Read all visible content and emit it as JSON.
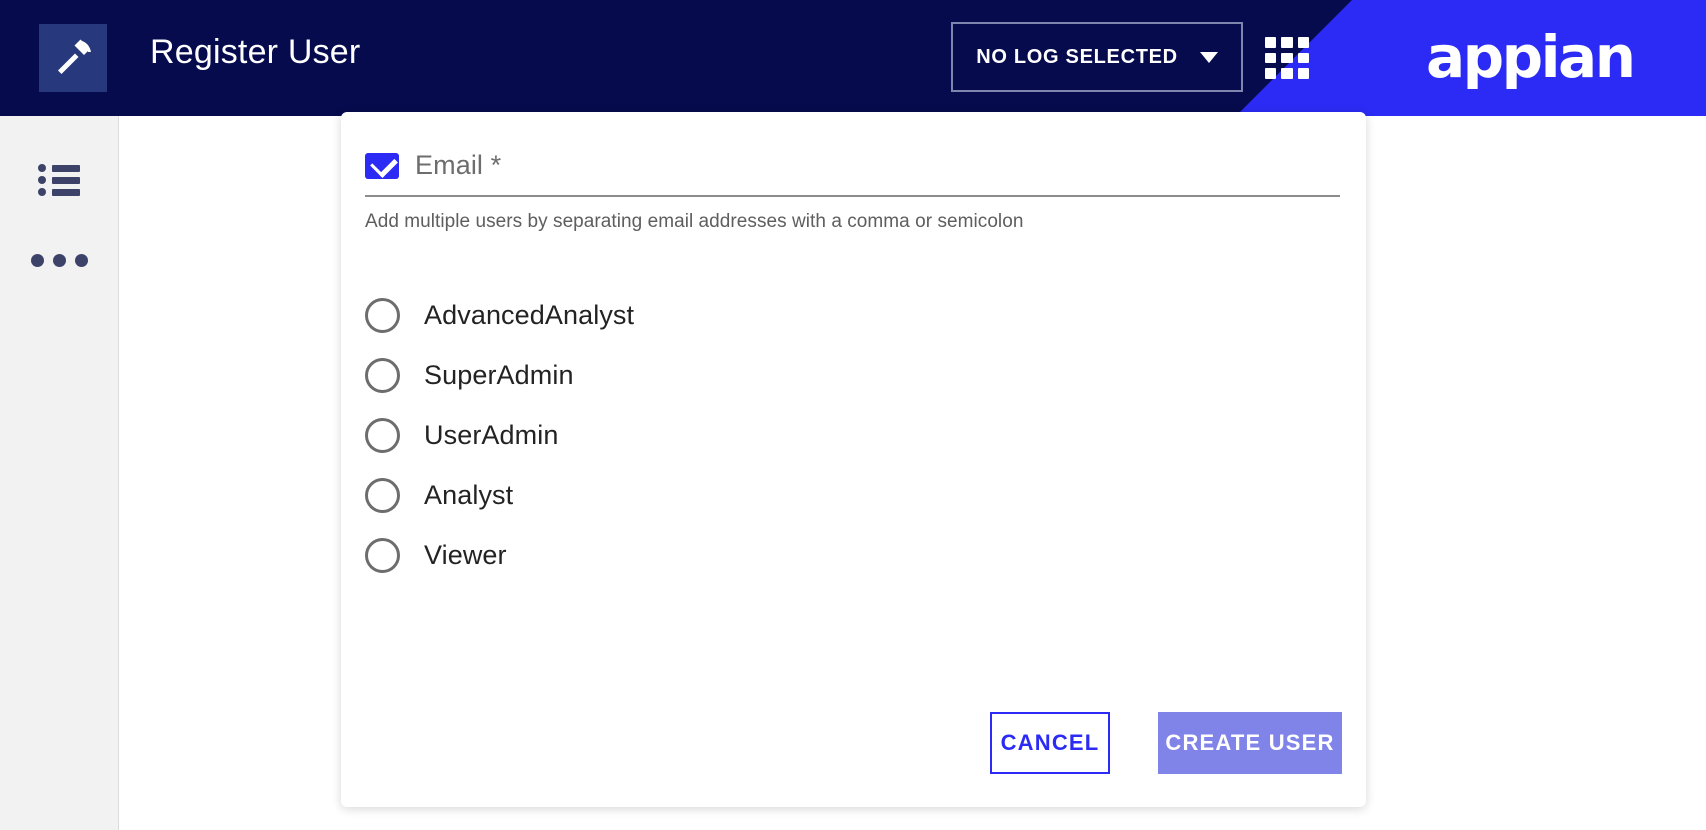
{
  "header": {
    "app_logo_icon": "hammer-icon",
    "title": "Register User",
    "log_selector": {
      "label": "NO LOG SELECTED",
      "caret_icon": "chevron-down-icon"
    },
    "grid_icon": "apps-grid-icon",
    "brand": "appian",
    "colors": {
      "header_bg": "#060b4d",
      "brand_banner": "#2b2bf5",
      "logo_square": "#27387d"
    }
  },
  "sidebar": {
    "items": [
      {
        "name": "list",
        "icon": "list-icon"
      },
      {
        "name": "more",
        "icon": "more-horizontal-icon"
      }
    ]
  },
  "form": {
    "email_field": {
      "icon": "envelope-icon",
      "placeholder": "Email *",
      "value": "",
      "helper_text": "Add multiple users by separating email addresses with a comma or semicolon"
    },
    "roles": [
      {
        "label": "AdvancedAnalyst",
        "selected": false
      },
      {
        "label": "SuperAdmin",
        "selected": false
      },
      {
        "label": "UserAdmin",
        "selected": false
      },
      {
        "label": "Analyst",
        "selected": false
      },
      {
        "label": "Viewer",
        "selected": false
      }
    ],
    "buttons": {
      "cancel": "CANCEL",
      "create": "CREATE USER"
    },
    "colors": {
      "accent": "#2b2bf5",
      "create_button_bg": "#8084e8"
    }
  }
}
